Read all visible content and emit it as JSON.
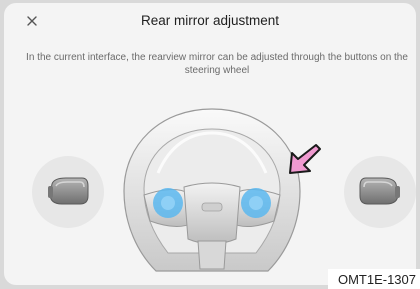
{
  "dialog": {
    "title": "Rear mirror adjustment",
    "description": "In the current interface, the rearview mirror can be adjusted through the buttons on the steering wheel"
  },
  "icons": {
    "close": "close-icon",
    "left_mirror": "left-mirror-icon",
    "right_mirror": "right-mirror-icon",
    "steering_wheel": "steering-wheel-illustration",
    "pointer_arrow": "pointer-arrow-icon"
  },
  "colors": {
    "highlight": "#5ab7ee",
    "arrow": "#f09ad0",
    "panel": "#f4f4f4"
  },
  "caption": "OMT1E-1307"
}
